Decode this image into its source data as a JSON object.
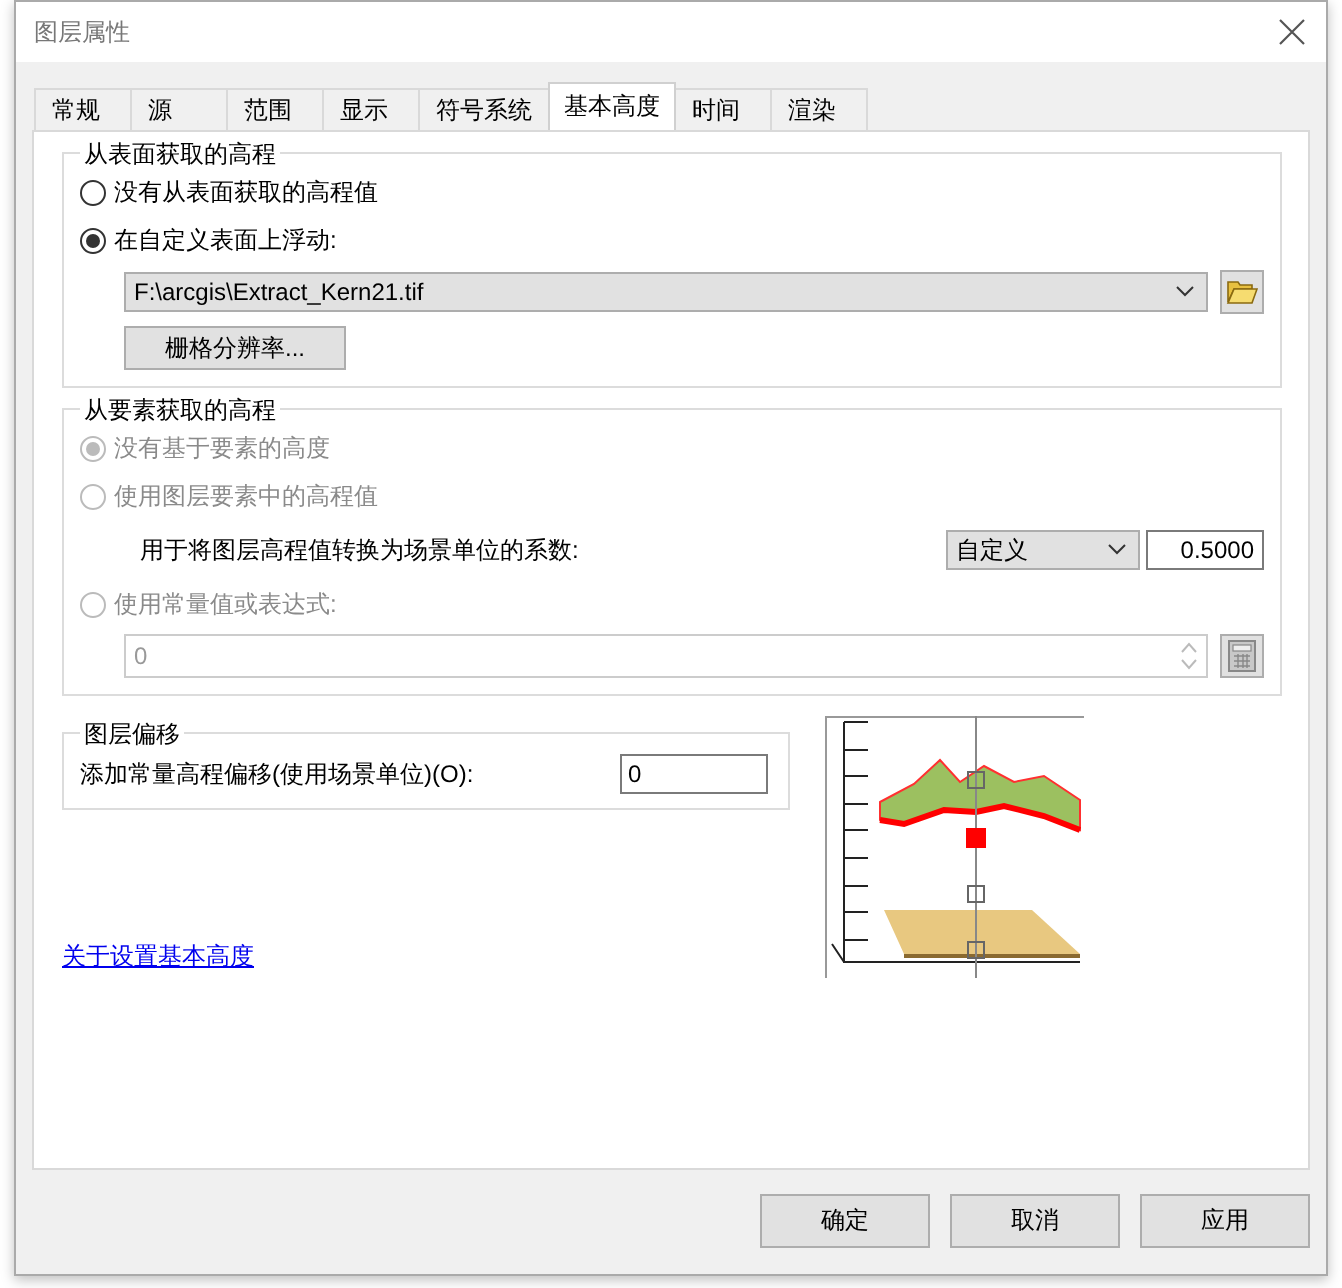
{
  "window": {
    "title": "图层属性"
  },
  "tabs": [
    {
      "label": "常规",
      "selected": false
    },
    {
      "label": "源",
      "selected": false
    },
    {
      "label": "范围",
      "selected": false
    },
    {
      "label": "显示",
      "selected": false
    },
    {
      "label": "符号系统",
      "selected": false
    },
    {
      "label": "基本高度",
      "selected": true
    },
    {
      "label": "时间",
      "selected": false
    },
    {
      "label": "渲染",
      "selected": false
    }
  ],
  "surface_group": {
    "title": "从表面获取的高程",
    "options": [
      {
        "label": "没有从表面获取的高程值",
        "selected": false
      },
      {
        "label": "在自定义表面上浮动:",
        "selected": true
      }
    ],
    "surface_path": "F:\\arcgis\\Extract_Kern21.tif",
    "resolution_button": "栅格分辨率..."
  },
  "feature_group": {
    "title": "从要素获取的高程",
    "options": [
      {
        "label": "没有基于要素的高度",
        "selected": true,
        "disabled": true
      },
      {
        "label": "使用图层要素中的高程值",
        "selected": false,
        "disabled": true
      },
      {
        "label": "使用常量值或表达式:",
        "selected": false,
        "disabled": true
      }
    ],
    "factor_label": "用于将图层高程值转换为场景单位的系数:",
    "factor_unit": "自定义",
    "factor_value": "0.5000",
    "expression_value": "0",
    "expression_disabled": true
  },
  "offset_group": {
    "title": "图层偏移",
    "label": "添加常量高程偏移(使用场景单位)(O):",
    "value": "0"
  },
  "help_link": "关于设置基本高度",
  "buttons": [
    {
      "label": "确定"
    },
    {
      "label": "取消"
    },
    {
      "label": "应用"
    }
  ]
}
